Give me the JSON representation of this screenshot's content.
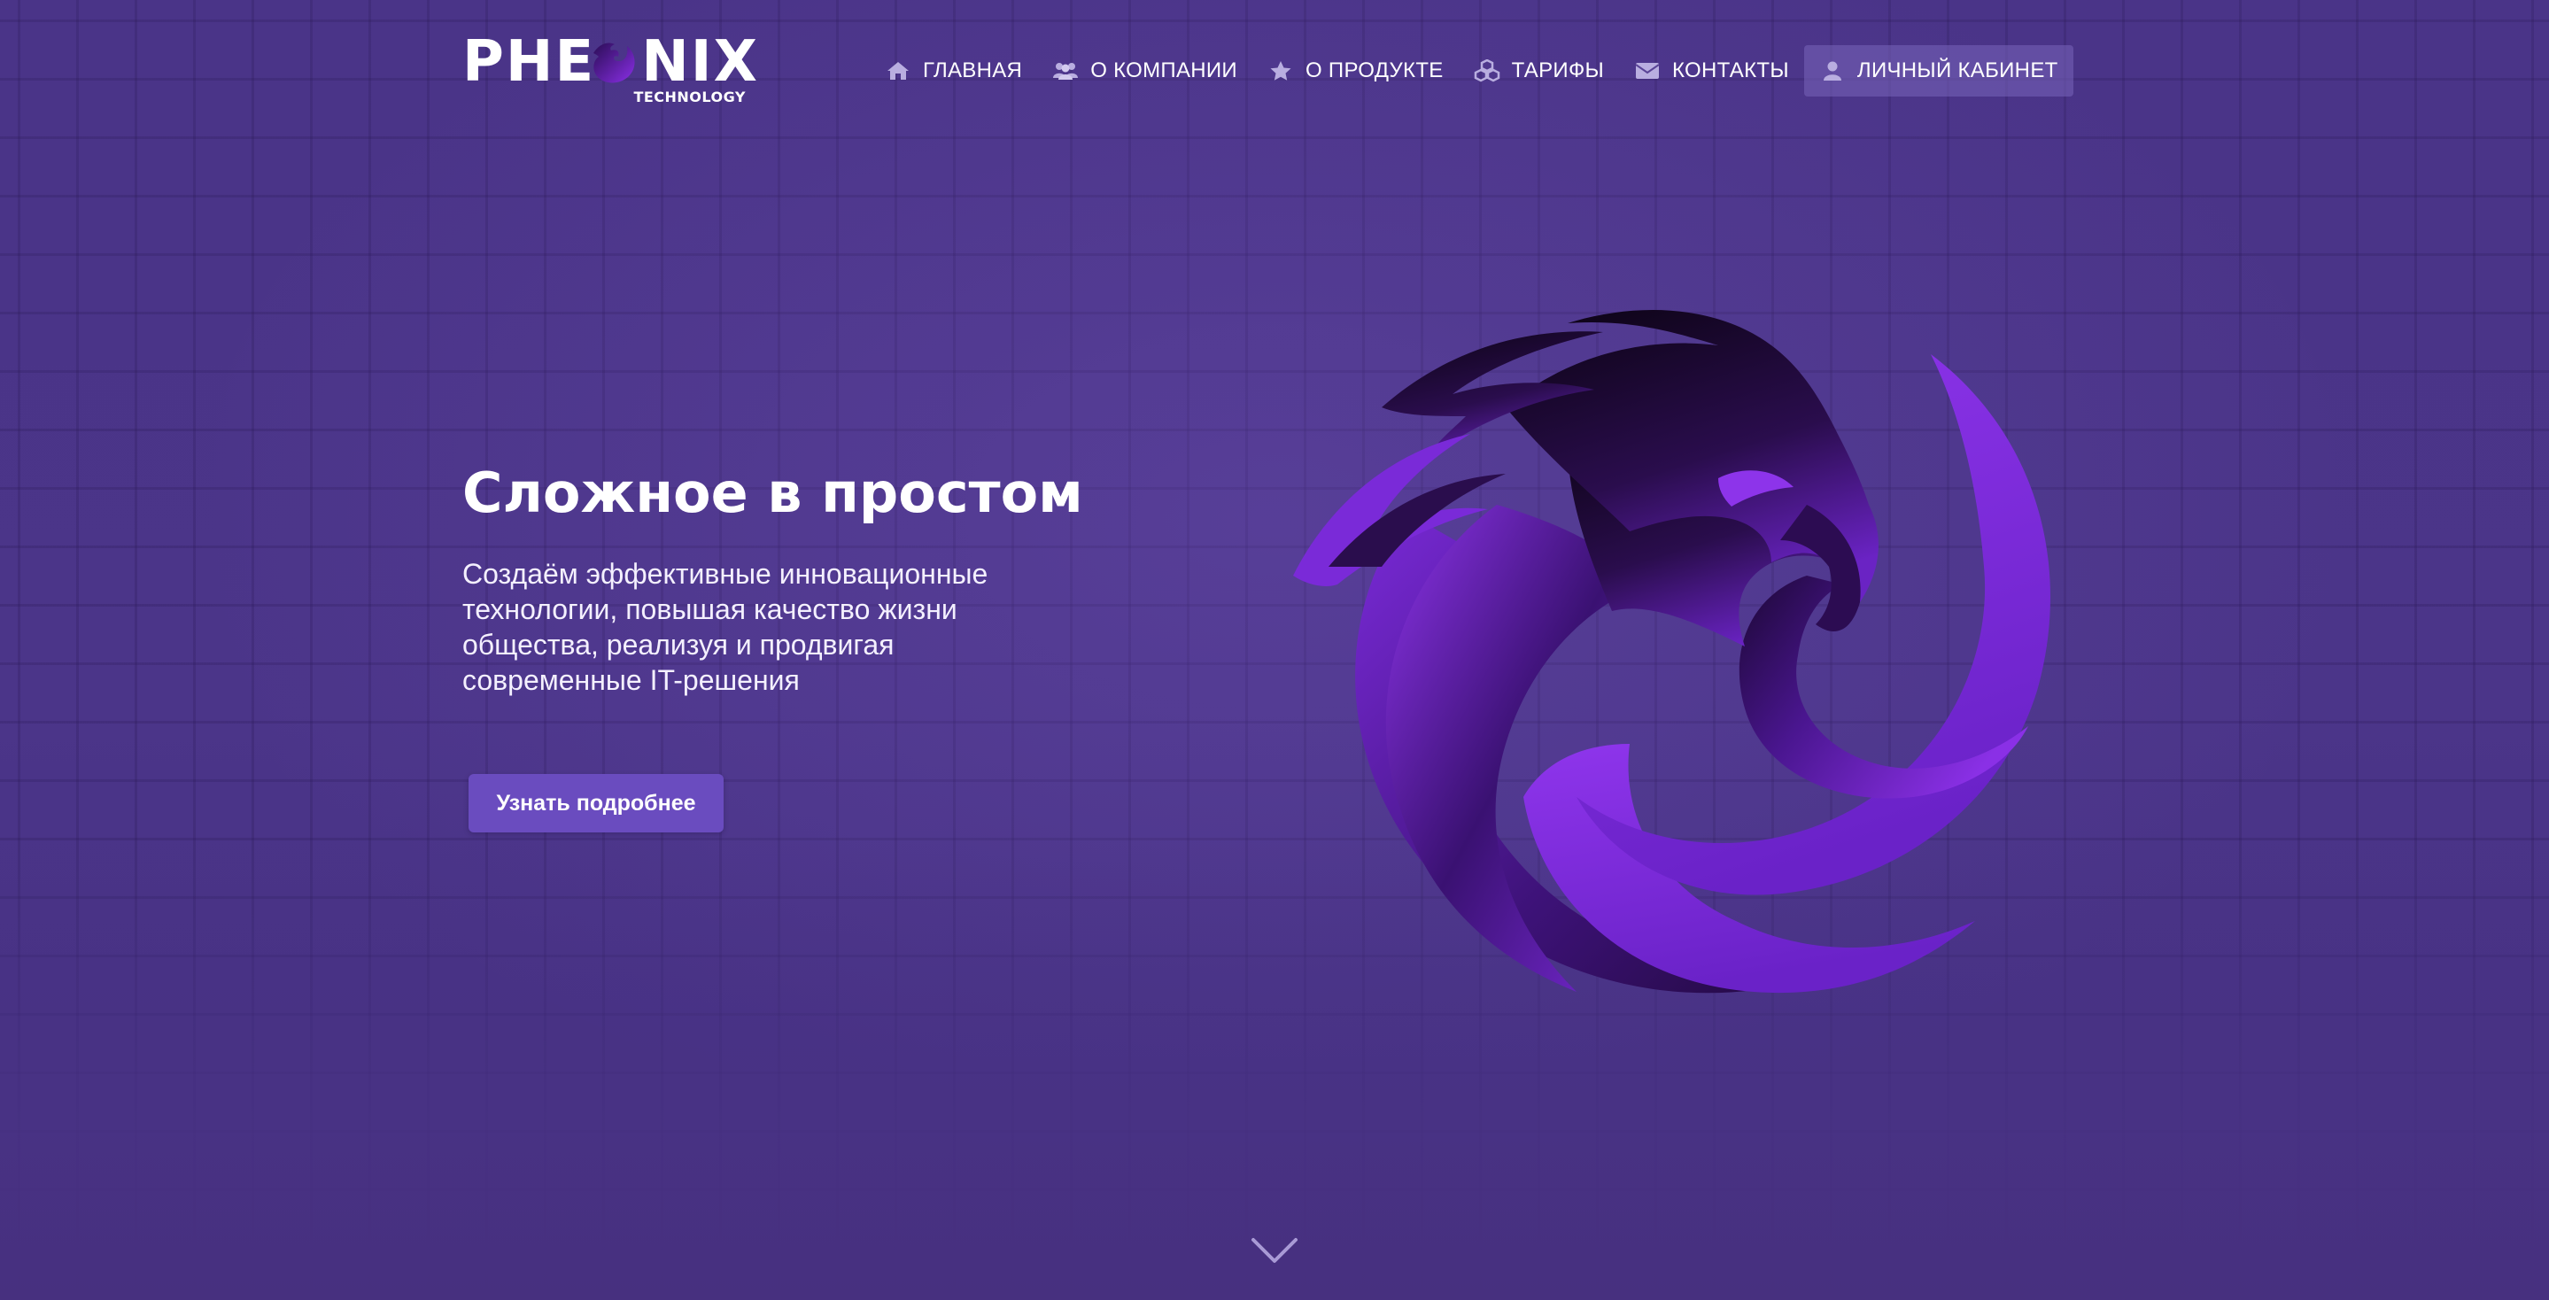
{
  "brand": {
    "name_left": "PHE",
    "name_right": "NIX",
    "subtitle": "TECHNOLOGY",
    "accent_color": "#7c2ee0"
  },
  "nav": {
    "items": [
      {
        "label": "ГЛАВНАЯ",
        "icon": "home-icon"
      },
      {
        "label": "О КОМПАНИИ",
        "icon": "users-icon"
      },
      {
        "label": "О ПРОДУКТЕ",
        "icon": "star-icon"
      },
      {
        "label": "ТАРИФЫ",
        "icon": "cubes-icon"
      },
      {
        "label": "КОНТАКТЫ",
        "icon": "envelope-icon"
      },
      {
        "label": "ЛИЧНЫЙ КАБИНЕТ",
        "icon": "user-icon",
        "active": true
      }
    ]
  },
  "hero": {
    "title": "Сложное в простом",
    "text": "Создаём эффективные инновационные технологии, повышая качество жизни общества, реализуя и продвигая современные IT-решения",
    "button_label": "Узнать подробнее",
    "illustration": "phoenix-icon"
  },
  "scroll": {
    "icon": "chevron-down-icon"
  },
  "colors": {
    "background": "#4b3589",
    "button": "#6a4cbf",
    "phoenix_light": "#8a2fe6",
    "phoenix_dark": "#1a0a30"
  }
}
